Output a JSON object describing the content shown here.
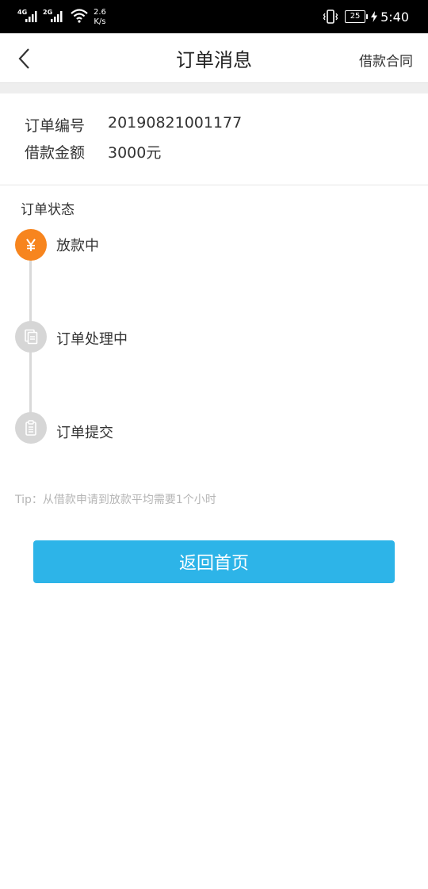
{
  "status_bar": {
    "network1": "4G",
    "network2": "2G",
    "speed_value": "2.6",
    "speed_unit": "K/s",
    "battery": "25",
    "time": "5:40"
  },
  "nav": {
    "title": "订单消息",
    "right_link": "借款合同"
  },
  "order": {
    "number_label": "订单编号",
    "number_value": "20190821001177",
    "amount_label": "借款金额",
    "amount_value": "3000元"
  },
  "status": {
    "title": "订单状态",
    "steps": [
      {
        "label": "放款中",
        "icon": "yuan-icon",
        "active": true
      },
      {
        "label": "订单处理中",
        "icon": "documents-icon",
        "active": false
      },
      {
        "label": "订单提交",
        "icon": "clipboard-icon",
        "active": false
      }
    ]
  },
  "tip": "Tip：从借款申请到放款平均需要1个小时",
  "button": {
    "label": "返回首页"
  },
  "colors": {
    "accent_orange": "#f7851e",
    "primary_blue": "#2db4e8",
    "inactive_gray": "#d6d6d6"
  }
}
